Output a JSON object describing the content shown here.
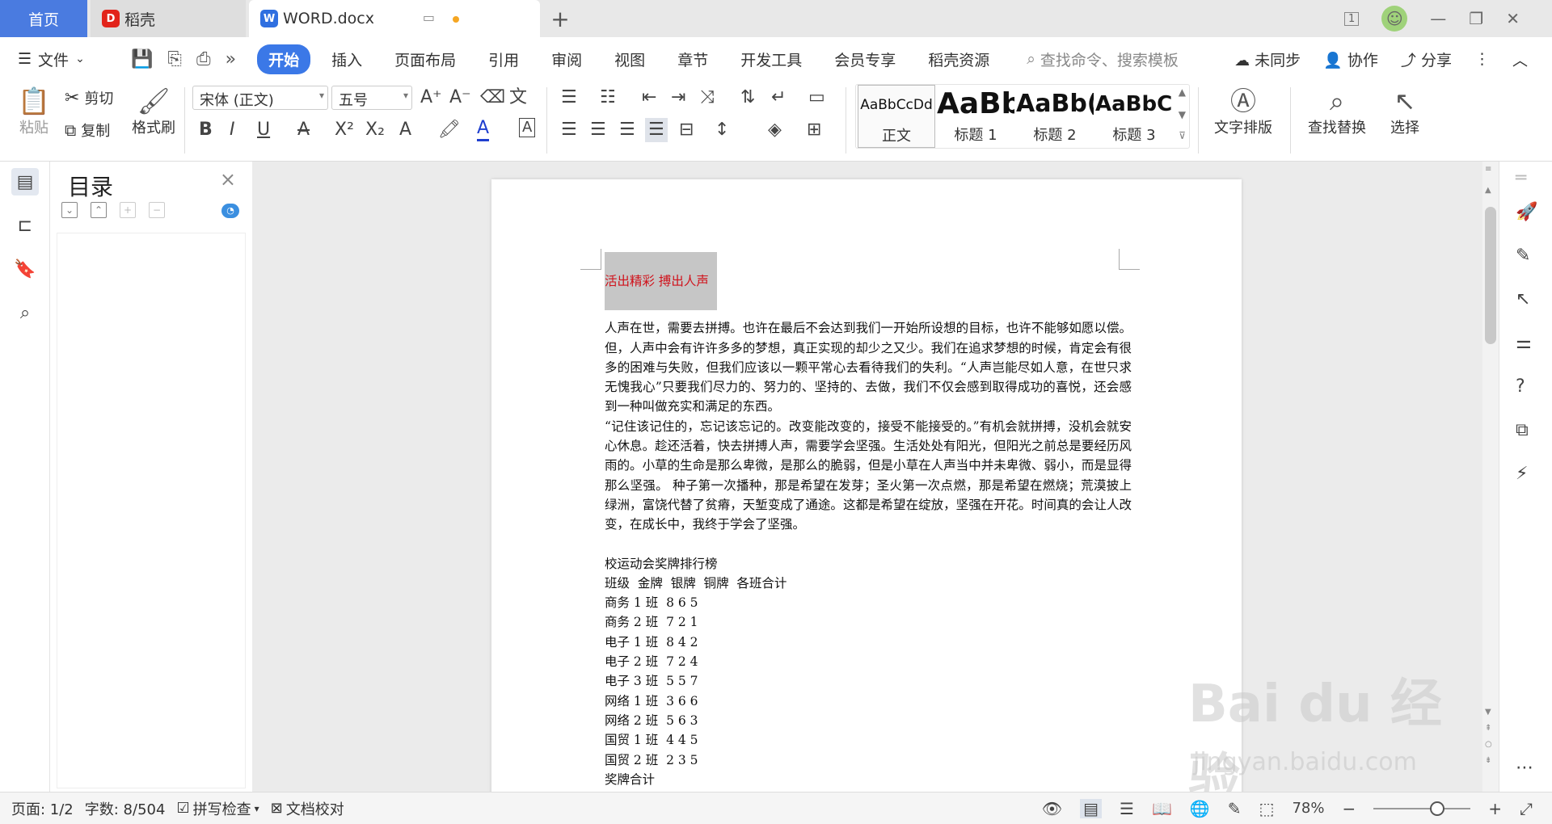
{
  "titlebar": {
    "home_tab": "首页",
    "daoke_tab": "稻壳",
    "doc_tab": "WORD.docx",
    "new_tab": "+",
    "page_indicator": "1"
  },
  "menu": {
    "file": "文件",
    "tabs": [
      "开始",
      "插入",
      "页面布局",
      "引用",
      "审阅",
      "视图",
      "章节",
      "开发工具",
      "会员专享",
      "稻壳资源"
    ],
    "search_placeholder": "查找命令、搜索模板",
    "sync": "未同步",
    "collab": "协作",
    "share": "分享"
  },
  "ribbon": {
    "paste": "粘贴",
    "cut": "剪切",
    "copy": "复制",
    "format_painter": "格式刷",
    "font_name": "宋体 (正文)",
    "font_size": "五号",
    "styles": [
      {
        "preview": "AaBbCcDd",
        "name": "正文"
      },
      {
        "preview": "AaBb",
        "name": "标题 1"
      },
      {
        "preview": "AaBb(",
        "name": "标题 2"
      },
      {
        "preview": "AaBbC(",
        "name": "标题 3"
      }
    ],
    "text_layout": "文字排版",
    "find_replace": "查找替换",
    "select": "选择"
  },
  "toc": {
    "title": "目录"
  },
  "document": {
    "heading": "活出精彩  搏出人声",
    "para1": "人声在世，需要去拼搏。也许在最后不会达到我们一开始所设想的目标，也许不能够如愿以偿。但，人声中会有许许多多的梦想，真正实现的却少之又少。我们在追求梦想的时候，肯定会有很多的困难与失败，但我们应该以一颗平常心去看待我们的失利。“人声岂能尽如人意，在世只求无愧我心”只要我们尽力的、努力的、坚持的、去做，我们不仅会感到取得成功的喜悦，还会感到一种叫做充实和满足的东西。",
    "para2": "“记住该记住的，忘记该忘记的。改变能改变的，接受不能接受的。”有机会就拼搏，没机会就安心休息。趁还活着，快去拼搏人声，需要学会坚强。生活处处有阳光，但阳光之前总是要经历风雨的。小草的生命是那么卑微，是那么的脆弱，但是小草在人声当中并未卑微、弱小，而是显得那么坚强。 种子第一次播种，那是希望在发芽；圣火第一次点燃，那是希望在燃烧；荒漠披上绿洲，富饶代替了贫瘠，天堑变成了通途。这都是希望在绽放，坚强在开花。时间真的会让人改变，在成长中，我终于学会了坚强。",
    "table_title": "校运动会奖牌排行榜",
    "table_header": "班级  金牌  银牌  铜牌  各班合计",
    "rows": [
      "商务 1 班  8 6 5",
      "商务 2 班  7 2 1",
      "电子 1 班  8 4 2",
      "电子 2 班  7 2 4",
      "电子 3 班  5 5 7",
      "网络 1 班  3 6 6",
      "网络 2 班  5 6 3",
      "国贸 1 班  4 4 5",
      "国贸 2 班  2 3 5",
      "奖牌合计"
    ]
  },
  "status": {
    "page": "页面: 1/2",
    "words": "字数: 8/504",
    "spell_check": "拼写检查",
    "doc_check": "文档校对",
    "zoom": "78%"
  },
  "watermark": {
    "brand": "Bai du 经验",
    "url": "jingyan.baidu.com"
  },
  "colors": {
    "accent": "#3b78e7",
    "home_tab": "#4a7be0",
    "heading_text": "#d0121b",
    "selection_bg": "#c6c6c6"
  }
}
